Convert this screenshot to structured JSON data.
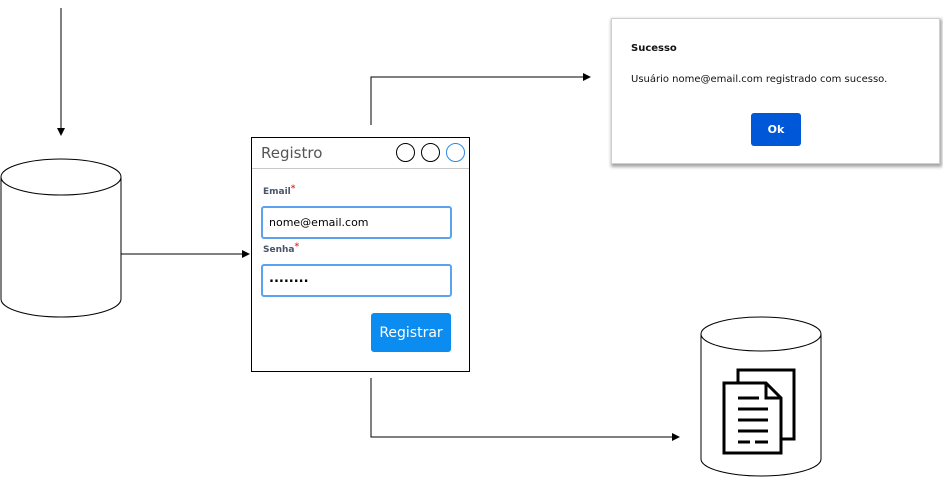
{
  "form": {
    "title": "Registro",
    "email_label": "Email",
    "email_value": "nome@email.com",
    "password_label": "Senha",
    "password_value": "........",
    "required_mark": "*",
    "submit_label": "Registrar"
  },
  "dialog": {
    "title": "Sucesso",
    "message": "Usuário nome@email.com registrado com sucesso.",
    "ok_label": "Ok"
  },
  "colors": {
    "primary_button": "#0a8cf0",
    "ok_button": "#0057d8",
    "field_border": "#5ba3f0",
    "required": "#e53935"
  }
}
